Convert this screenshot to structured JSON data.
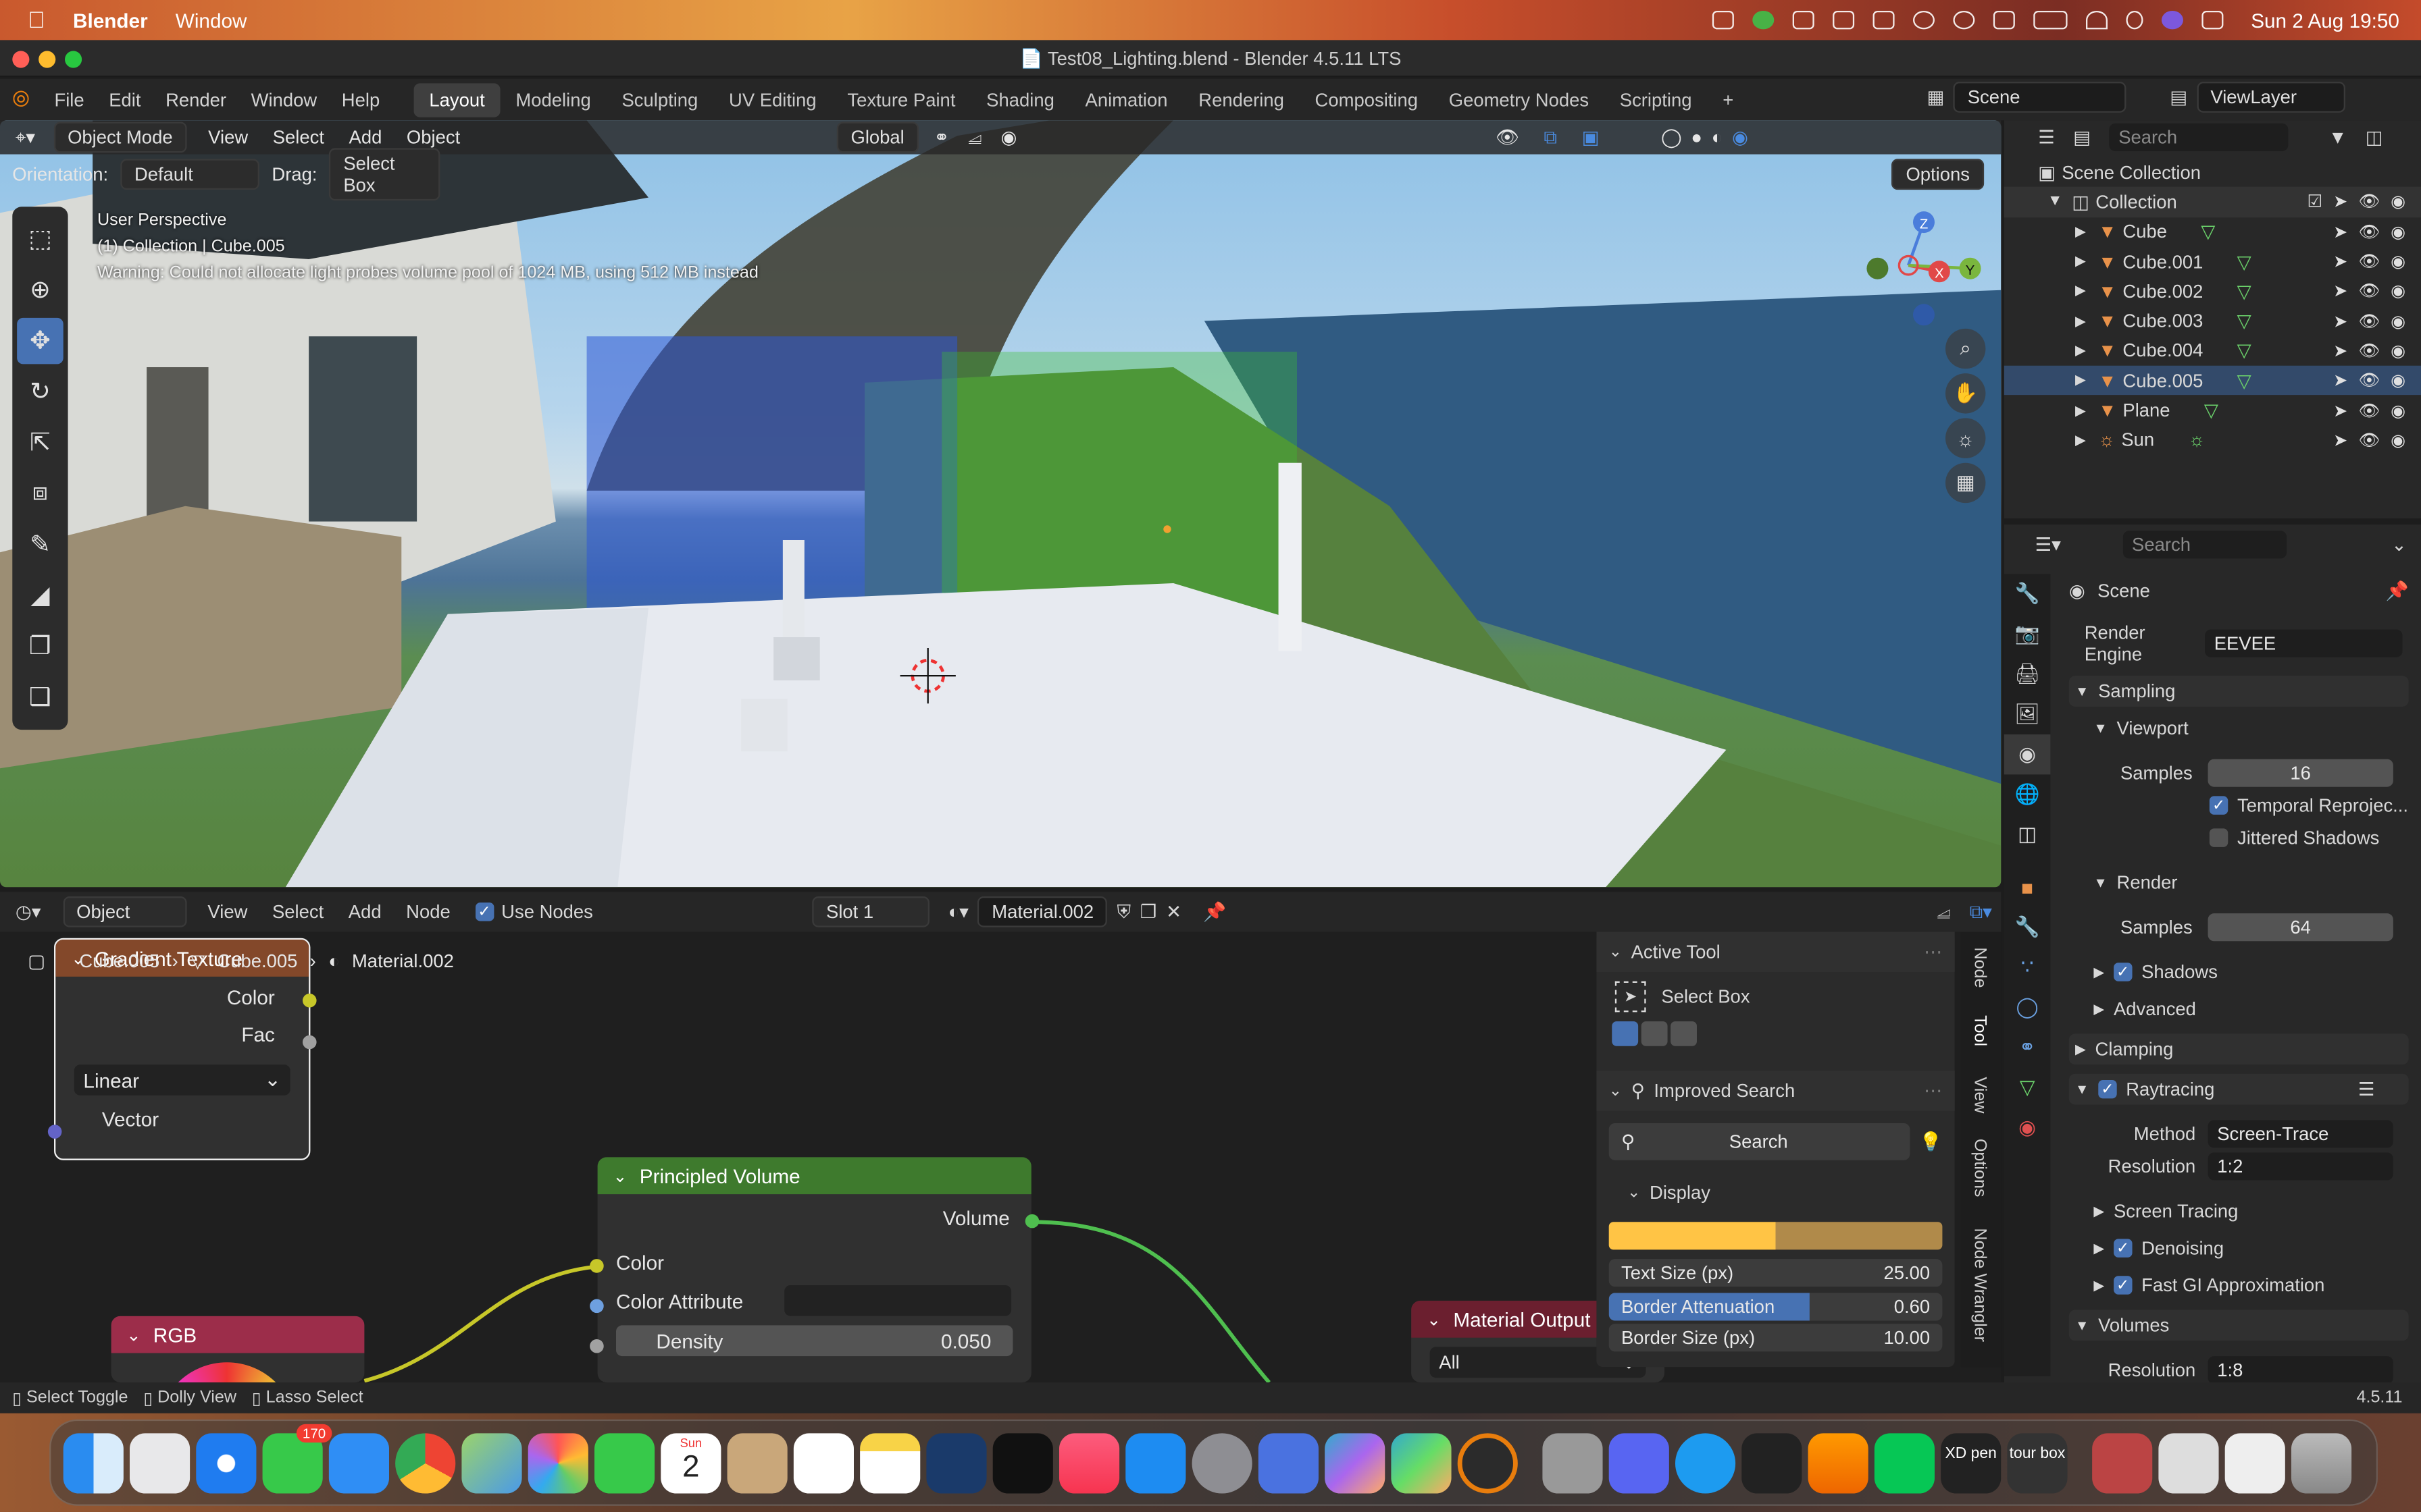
{
  "menubar": {
    "app_name": "Blender",
    "items": [
      "Window"
    ],
    "datetime": "Sun 2 Aug  19:50"
  },
  "window": {
    "title": "Test08_Lighting.blend - Blender 4.5.11 LTS"
  },
  "topbar": {
    "menus": [
      "File",
      "Edit",
      "Render",
      "Window",
      "Help"
    ],
    "workspaces": [
      "Layout",
      "Modeling",
      "Sculpting",
      "UV Editing",
      "Texture Paint",
      "Shading",
      "Animation",
      "Rendering",
      "Compositing",
      "Geometry Nodes",
      "Scripting"
    ],
    "active_workspace": "Layout",
    "add_workspace": "+",
    "scene": "Scene",
    "view_layer": "ViewLayer"
  },
  "viewport": {
    "mode": "Object Mode",
    "menus": [
      "View",
      "Select",
      "Add",
      "Object"
    ],
    "transform": "Global",
    "orientation_label": "Orientation:",
    "orientation_value": "Default",
    "drag_label": "Drag:",
    "drag_value": "Select Box",
    "options": "Options",
    "overlay_line1": "User Perspective",
    "overlay_line2": "(1) Collection | Cube.005",
    "overlay_line3": "Warning: Could not allocate light probes volume pool of 1024 MB, using 512 MB instead",
    "gizmo": {
      "z": "Z",
      "x": "X",
      "y": "Y"
    }
  },
  "outliner": {
    "search_placeholder": "Search",
    "scene_collection": "Scene Collection",
    "collection": "Collection",
    "objects": [
      "Cube",
      "Cube.001",
      "Cube.002",
      "Cube.003",
      "Cube.004",
      "Cube.005",
      "Plane",
      "Sun"
    ]
  },
  "properties": {
    "search_placeholder": "Search",
    "context": "Scene",
    "render_engine_label": "Render Engine",
    "render_engine": "EEVEE",
    "sampling": "Sampling",
    "viewport": "Viewport",
    "viewport_samples_label": "Samples",
    "viewport_samples": "16",
    "temporal_reprojection": "Temporal Reprojec...",
    "jittered_shadows": "Jittered Shadows",
    "render": "Render",
    "render_samples_label": "Samples",
    "render_samples": "64",
    "shadows": "Shadows",
    "advanced": "Advanced",
    "clamping": "Clamping",
    "raytracing": "Raytracing",
    "method_label": "Method",
    "method": "Screen-Trace",
    "resolution_label": "Resolution",
    "resolution": "1:2",
    "screen_tracing": "Screen Tracing",
    "denoising": "Denoising",
    "fast_gi": "Fast GI Approximation",
    "volumes": "Volumes",
    "vol_resolution_label": "Resolution",
    "vol_resolution": "1:8"
  },
  "node_editor": {
    "type": "Object",
    "menus": [
      "View",
      "Select",
      "Add",
      "Node"
    ],
    "use_nodes": "Use Nodes",
    "slot": "Slot 1",
    "material": "Material.002",
    "breadcrumb": [
      "Cube.005",
      "Cube.005",
      "Material.002"
    ],
    "gradient_node": {
      "title": "Gradient Texture",
      "outputs": [
        "Color",
        "Fac"
      ],
      "mode": "Linear",
      "input": "Vector"
    },
    "principled_node": {
      "title": "Principled Volume",
      "output": "Volume",
      "inputs": [
        "Color",
        "Color Attribute",
        "Density"
      ],
      "density": "0.050"
    },
    "rgb_node": {
      "title": "RGB"
    },
    "output_node": {
      "title": "Material Output",
      "target": "All"
    }
  },
  "npanel": {
    "active_tool": "Active Tool",
    "tool_name": "Select Box",
    "improved_search": "Improved Search",
    "search_button": "Search",
    "display": "Display",
    "text_size_label": "Text Size (px)",
    "text_size": "25.00",
    "border_attenuation_label": "Border Attenuation",
    "border_attenuation": "0.60",
    "border_attenuation_fraction": 0.6,
    "border_size_label": "Border Size (px)",
    "border_size": "10.00",
    "tabs": [
      "Node",
      "Tool",
      "View",
      "Options",
      "Node Wrangler"
    ]
  },
  "statusbar": {
    "items": [
      "Select Toggle",
      "Dolly View",
      "Lasso Select"
    ],
    "version": "4.5.11"
  },
  "dock": {
    "calendar_day": "2",
    "calendar_month": "Sun",
    "messages_badge": "170",
    "app_labels": [
      "XD pen",
      "tour box"
    ]
  },
  "colors": {
    "accent": "#4772b3",
    "node_texture": "#83482a",
    "node_shader": "#3e7a2d",
    "node_input": "#9c2d4a",
    "node_output": "#6b1f2f"
  }
}
